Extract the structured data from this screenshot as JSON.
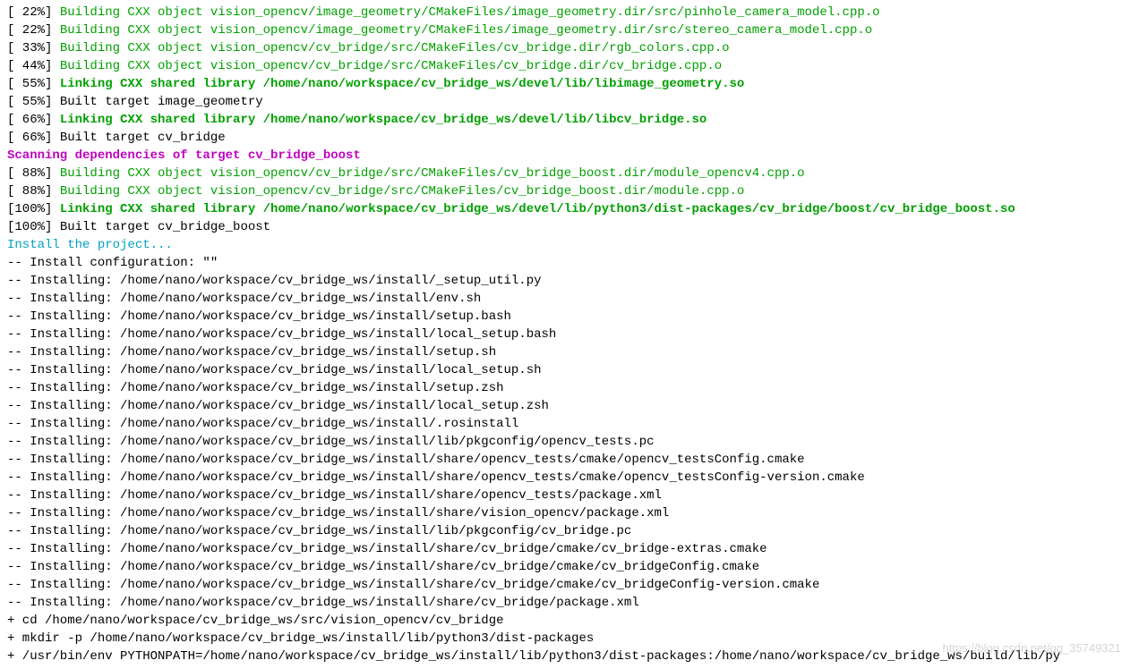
{
  "build": [
    {
      "pct": "[ 22%]",
      "kind": "green",
      "text": "Building CXX object vision_opencv/image_geometry/CMakeFiles/image_geometry.dir/src/pinhole_camera_model.cpp.o"
    },
    {
      "pct": "[ 22%]",
      "kind": "green",
      "text": "Building CXX object vision_opencv/image_geometry/CMakeFiles/image_geometry.dir/src/stereo_camera_model.cpp.o"
    },
    {
      "pct": "[ 33%]",
      "kind": "green",
      "text": "Building CXX object vision_opencv/cv_bridge/src/CMakeFiles/cv_bridge.dir/rgb_colors.cpp.o"
    },
    {
      "pct": "[ 44%]",
      "kind": "green",
      "text": "Building CXX object vision_opencv/cv_bridge/src/CMakeFiles/cv_bridge.dir/cv_bridge.cpp.o"
    },
    {
      "pct": "[ 55%]",
      "kind": "green-bold",
      "text": "Linking CXX shared library /home/nano/workspace/cv_bridge_ws/devel/lib/libimage_geometry.so"
    },
    {
      "pct": "[ 55%]",
      "kind": "black",
      "text": "Built target image_geometry"
    },
    {
      "pct": "[ 66%]",
      "kind": "green-bold",
      "text": "Linking CXX shared library /home/nano/workspace/cv_bridge_ws/devel/lib/libcv_bridge.so"
    },
    {
      "pct": "[ 66%]",
      "kind": "black",
      "text": "Built target cv_bridge"
    }
  ],
  "scan": "Scanning dependencies of target cv_bridge_boost",
  "build2": [
    {
      "pct": "[ 88%]",
      "kind": "green",
      "text": "Building CXX object vision_opencv/cv_bridge/src/CMakeFiles/cv_bridge_boost.dir/module_opencv4.cpp.o"
    },
    {
      "pct": "[ 88%]",
      "kind": "green",
      "text": "Building CXX object vision_opencv/cv_bridge/src/CMakeFiles/cv_bridge_boost.dir/module.cpp.o"
    },
    {
      "pct": "[100%]",
      "kind": "green-bold",
      "text": "Linking CXX shared library /home/nano/workspace/cv_bridge_ws/devel/lib/python3/dist-packages/cv_bridge/boost/cv_bridge_boost.so"
    },
    {
      "pct": "[100%]",
      "kind": "black",
      "text": "Built target cv_bridge_boost"
    }
  ],
  "install_header": "Install the project...",
  "install_lines": [
    "-- Install configuration: \"\"",
    "-- Installing: /home/nano/workspace/cv_bridge_ws/install/_setup_util.py",
    "-- Installing: /home/nano/workspace/cv_bridge_ws/install/env.sh",
    "-- Installing: /home/nano/workspace/cv_bridge_ws/install/setup.bash",
    "-- Installing: /home/nano/workspace/cv_bridge_ws/install/local_setup.bash",
    "-- Installing: /home/nano/workspace/cv_bridge_ws/install/setup.sh",
    "-- Installing: /home/nano/workspace/cv_bridge_ws/install/local_setup.sh",
    "-- Installing: /home/nano/workspace/cv_bridge_ws/install/setup.zsh",
    "-- Installing: /home/nano/workspace/cv_bridge_ws/install/local_setup.zsh",
    "-- Installing: /home/nano/workspace/cv_bridge_ws/install/.rosinstall",
    "-- Installing: /home/nano/workspace/cv_bridge_ws/install/lib/pkgconfig/opencv_tests.pc",
    "-- Installing: /home/nano/workspace/cv_bridge_ws/install/share/opencv_tests/cmake/opencv_testsConfig.cmake",
    "-- Installing: /home/nano/workspace/cv_bridge_ws/install/share/opencv_tests/cmake/opencv_testsConfig-version.cmake",
    "-- Installing: /home/nano/workspace/cv_bridge_ws/install/share/opencv_tests/package.xml",
    "-- Installing: /home/nano/workspace/cv_bridge_ws/install/share/vision_opencv/package.xml",
    "-- Installing: /home/nano/workspace/cv_bridge_ws/install/lib/pkgconfig/cv_bridge.pc",
    "-- Installing: /home/nano/workspace/cv_bridge_ws/install/share/cv_bridge/cmake/cv_bridge-extras.cmake",
    "-- Installing: /home/nano/workspace/cv_bridge_ws/install/share/cv_bridge/cmake/cv_bridgeConfig.cmake",
    "-- Installing: /home/nano/workspace/cv_bridge_ws/install/share/cv_bridge/cmake/cv_bridgeConfig-version.cmake",
    "-- Installing: /home/nano/workspace/cv_bridge_ws/install/share/cv_bridge/package.xml",
    "+ cd /home/nano/workspace/cv_bridge_ws/src/vision_opencv/cv_bridge",
    "+ mkdir -p /home/nano/workspace/cv_bridge_ws/install/lib/python3/dist-packages",
    "+ /usr/bin/env PYTHONPATH=/home/nano/workspace/cv_bridge_ws/install/lib/python3/dist-packages:/home/nano/workspace/cv_bridge_ws/build/lib/py"
  ],
  "watermark": "https://blog.csdn.net/qq_35749321"
}
